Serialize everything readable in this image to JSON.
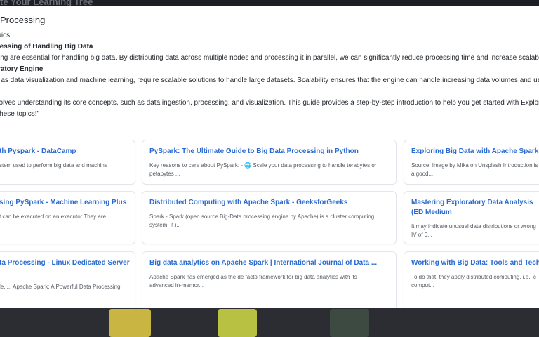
{
  "background": {
    "header_text": "te Your Learning Tree"
  },
  "modal": {
    "title": "Processing",
    "lines": [
      {
        "text": "topics:",
        "bold": false
      },
      {
        "text": "ocessing of Handling Big Data",
        "bold": true
      },
      {
        "text": "ssing are essential for handling big data. By distributing data across multiple nodes and processing it in parallel, we can significantly reduce processing time and increase scalability.",
        "bold": false
      },
      {
        "text": "loratory Engine",
        "bold": true
      },
      {
        "text": "ch as data visualization and machine learning, require scalable solutions to handle large datasets. Scalability ensures that the engine can handle increasing data volumes and user tra",
        "bold": false
      },
      {
        "text": "ne",
        "bold": true
      },
      {
        "text": "nvolves understanding its core concepts, such as data ingestion, processing, and visualization. This guide provides a step-by-step introduction to help you get started with Exploratory I",
        "bold": false
      },
      {
        "text": "n these topics!\"",
        "bold": false
      }
    ]
  },
  "results": [
    {
      "title": "th Pyspark - DataCamp",
      "snippet": "stem used to perform big data and machine"
    },
    {
      "title": "PySpark: The Ultimate Guide to Big Data Processing in Python",
      "snippet": "Key reasons to care about PySpark: - 🌐 Scale your data processing to handle terabytes or petabytes ..."
    },
    {
      "title": "Exploring Big Data with Apache Spark: I",
      "snippet": "Source: Image by Mika on Unsplash Introduction is a good..."
    },
    {
      "title": "sing PySpark - Machine Learning Plus",
      "snippet": "t can be executed on an executor They are"
    },
    {
      "title": "Distributed Computing with Apache Spark - GeeksforGeeks",
      "snippet": "Spark - Spark (open source Big-Data processing engine by Apache) is a cluster computing system. It i..."
    },
    {
      "title": "Mastering Exploratory Data Analysis (ED Medium",
      "snippet": "It may indicate unusual data distributions or wrong IV of 0..."
    },
    {
      "title": "ta Processing - Linux Dedicated Server",
      "snippet": "le. ... Apache Spark: A Powerful Data Processing"
    },
    {
      "title": "Big data analytics on Apache Spark | International Journal of Data ...",
      "snippet": "Apache Spark has emerged as the de facto framework for big data analytics with its advanced in-memor..."
    },
    {
      "title": "Working with Big Data: Tools and Techni",
      "snippet": "To do that, they apply distributed computing, i.e., c comput..."
    }
  ]
}
